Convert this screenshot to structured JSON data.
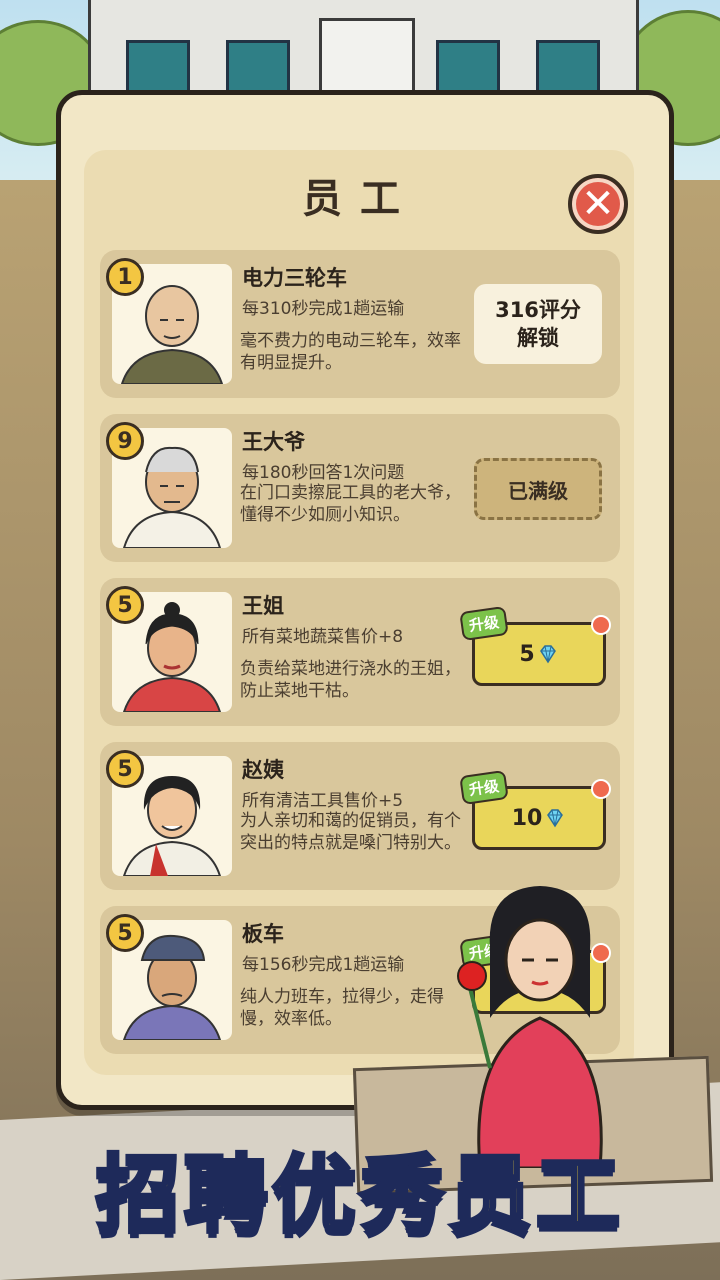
{
  "panel": {
    "title": "员工",
    "close_label": "✕"
  },
  "employees": [
    {
      "level": "1",
      "name": "电力三轮车",
      "effect": "每310秒完成1趟运输",
      "description": "毫不费力的电动三轮车，效率有明显提升。",
      "action": {
        "type": "unlock",
        "label": "316评分\n解锁"
      }
    },
    {
      "level": "9",
      "name": "王大爷",
      "effect": "每180秒回答1次问题",
      "description": "在门口卖擦屁工具的老大爷，懂得不少如厕小知识。",
      "action": {
        "type": "maxed",
        "label": "已满级"
      }
    },
    {
      "level": "5",
      "name": "王姐",
      "effect": "所有菜地蔬菜售价+8",
      "description": "负责给菜地进行浇水的王姐，防止菜地干枯。",
      "action": {
        "type": "upgrade",
        "tag": "升级",
        "cost": "5",
        "icon": "diamond-icon"
      }
    },
    {
      "level": "5",
      "name": "赵姨",
      "effect": "所有清洁工具售价+5",
      "description": "为人亲切和蔼的促销员，有个突出的特点就是嗓门特别大。",
      "action": {
        "type": "upgrade",
        "tag": "升级",
        "cost": "10",
        "icon": "diamond-icon"
      }
    },
    {
      "level": "5",
      "name": "板车",
      "effect": "每156秒完成1趟运输",
      "description": "纯人力班车，拉得少，走得慢，效率低。",
      "action": {
        "type": "upgrade",
        "tag": "升级",
        "cost": "",
        "icon": "diamond-icon"
      }
    }
  ],
  "banner": {
    "text": "招聘优秀员工"
  },
  "colors": {
    "panel_bg": "#f2e7c6",
    "card_bg": "#d9c79c",
    "upgrade_yellow": "#e9d65a",
    "close_red": "#e15a4a",
    "banner_yellow": "#f5d435",
    "banner_stroke": "#1e2a5a"
  }
}
